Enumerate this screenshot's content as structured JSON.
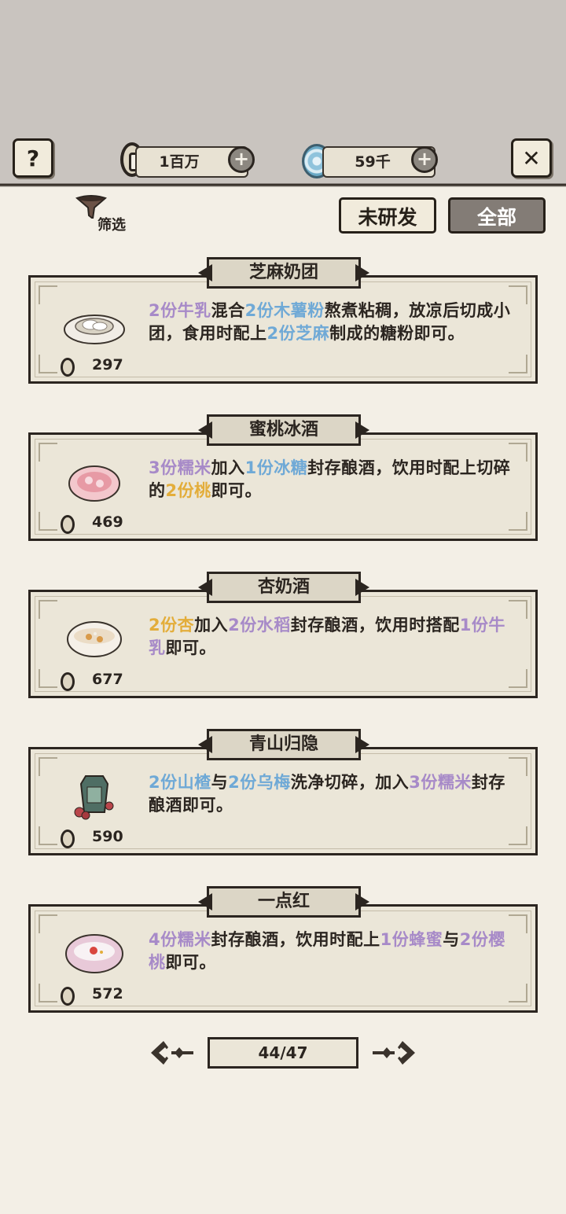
{
  "header": {
    "help_icon": "question-mark-icon",
    "close_icon": "close-icon",
    "coins_value": "1百万",
    "jade_value": "59千",
    "plus_symbol": "+"
  },
  "filter": {
    "label": "筛选"
  },
  "tabs": {
    "undeveloped_label": "未研发",
    "all_label": "全部"
  },
  "recipes": [
    {
      "name": "芝麻奶团",
      "price": "297",
      "segments": [
        {
          "t": "2份牛乳",
          "c": "purple"
        },
        {
          "t": "混合",
          "c": "plain"
        },
        {
          "t": "2份木薯粉",
          "c": "blue"
        },
        {
          "t": "熬煮粘稠，放凉后切成小团，食用时配上",
          "c": "plain"
        },
        {
          "t": "2份芝麻",
          "c": "blue"
        },
        {
          "t": "制成的糖粉即可。",
          "c": "plain"
        }
      ]
    },
    {
      "name": "蜜桃冰酒",
      "price": "469",
      "segments": [
        {
          "t": "3份糯米",
          "c": "purple"
        },
        {
          "t": "加入",
          "c": "plain"
        },
        {
          "t": "1份冰糖",
          "c": "blue"
        },
        {
          "t": "封存酿酒，饮用时配上切碎的",
          "c": "plain"
        },
        {
          "t": "2份桃",
          "c": "gold"
        },
        {
          "t": "即可。",
          "c": "plain"
        }
      ]
    },
    {
      "name": "杏奶酒",
      "price": "677",
      "segments": [
        {
          "t": "2份杏",
          "c": "gold"
        },
        {
          "t": "加入",
          "c": "plain"
        },
        {
          "t": "2份水稻",
          "c": "purple"
        },
        {
          "t": "封存酿酒，饮用时搭配",
          "c": "plain"
        },
        {
          "t": "1份牛乳",
          "c": "purple"
        },
        {
          "t": "即可。",
          "c": "plain"
        }
      ]
    },
    {
      "name": "青山归隐",
      "price": "590",
      "segments": [
        {
          "t": "2份山楂",
          "c": "blue"
        },
        {
          "t": "与",
          "c": "plain"
        },
        {
          "t": "2份乌梅",
          "c": "blue"
        },
        {
          "t": "洗净切碎，加入",
          "c": "plain"
        },
        {
          "t": "3份糯米",
          "c": "purple"
        },
        {
          "t": "封存酿酒即可。",
          "c": "plain"
        }
      ]
    },
    {
      "name": "一点红",
      "price": "572",
      "segments": [
        {
          "t": "4份糯米",
          "c": "purple"
        },
        {
          "t": "封存酿酒，饮用时配上",
          "c": "plain"
        },
        {
          "t": "1份蜂蜜",
          "c": "purple"
        },
        {
          "t": "与",
          "c": "plain"
        },
        {
          "t": "2份樱桃",
          "c": "purple"
        },
        {
          "t": "即可。",
          "c": "plain"
        }
      ]
    }
  ],
  "pager": {
    "text": "44/47"
  },
  "colors": {
    "purple": "#a78ac8",
    "blue": "#6fa9d6",
    "gold": "#e3ad3a"
  }
}
